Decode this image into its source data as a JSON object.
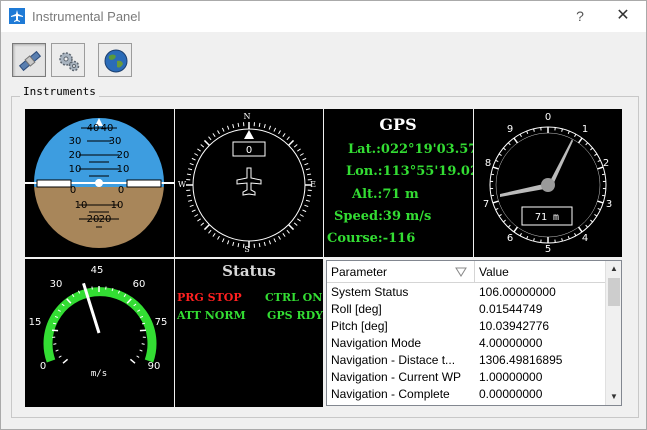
{
  "window": {
    "title": "Instrumental Panel",
    "help_label": "?",
    "close_label": "✕"
  },
  "toolbar": {
    "buttons": [
      {
        "icon": "satellite-icon",
        "pressed": true
      },
      {
        "icon": "gears-icon",
        "pressed": false
      },
      {
        "icon": "globe-icon",
        "pressed": false
      }
    ]
  },
  "group": {
    "title": "Instruments"
  },
  "attitude": {
    "scale_labels": [
      "40",
      "40",
      "30",
      "30",
      "20",
      "20",
      "10",
      "10",
      "0",
      "0",
      "10",
      "10",
      "20",
      "20"
    ],
    "sky_color": "#3d9de0",
    "ground_color": "#a8865a"
  },
  "compass": {
    "heading_value": "0",
    "cardinals": {
      "n": "N",
      "s": "S",
      "e": "E",
      "w": "W"
    },
    "heading_deg": 0
  },
  "gps": {
    "title": "GPS",
    "lines": [
      {
        "label": "Lat.:",
        "value": "022°19'03.57'"
      },
      {
        "label": "Lon.:",
        "value": "113°55'19.02'"
      },
      {
        "label": "Alt.:",
        "value": "71 m"
      },
      {
        "label": "Speed:",
        "value": "39 m/s"
      },
      {
        "label": "Course:",
        "value": "-116"
      }
    ],
    "text_color": "#33dd33"
  },
  "altimeter": {
    "readout": "71 m",
    "dial_numbers": [
      "0",
      "1",
      "2",
      "3",
      "4",
      "5",
      "6",
      "7",
      "8",
      "9"
    ]
  },
  "speedometer": {
    "ticks": [
      "0",
      "15",
      "30",
      "45",
      "60",
      "75",
      "90"
    ],
    "unit": "m/s",
    "value": 39,
    "arc_color": "#33dd33"
  },
  "status": {
    "title": "Status",
    "items": [
      {
        "text": "PRG STOP",
        "color": "#ff2020"
      },
      {
        "text": "CTRL ON",
        "color": "#33dd33"
      },
      {
        "text": "ATT NORM",
        "color": "#33dd33"
      },
      {
        "text": "GPS RDY",
        "color": "#33dd33"
      }
    ]
  },
  "table": {
    "headers": {
      "param": "Parameter",
      "value": "Value"
    },
    "rows": [
      {
        "param": "System Status",
        "value": "106.00000000"
      },
      {
        "param": "Roll [deg]",
        "value": "0.01544749"
      },
      {
        "param": "Pitch [deg]",
        "value": "10.03942776"
      },
      {
        "param": "Navigation Mode",
        "value": "4.00000000"
      },
      {
        "param": "Navigation - Distace t...",
        "value": "1306.49816895"
      },
      {
        "param": "Navigation - Current WP",
        "value": "1.00000000"
      },
      {
        "param": "Navigation - Complete",
        "value": "0.00000000"
      }
    ]
  }
}
